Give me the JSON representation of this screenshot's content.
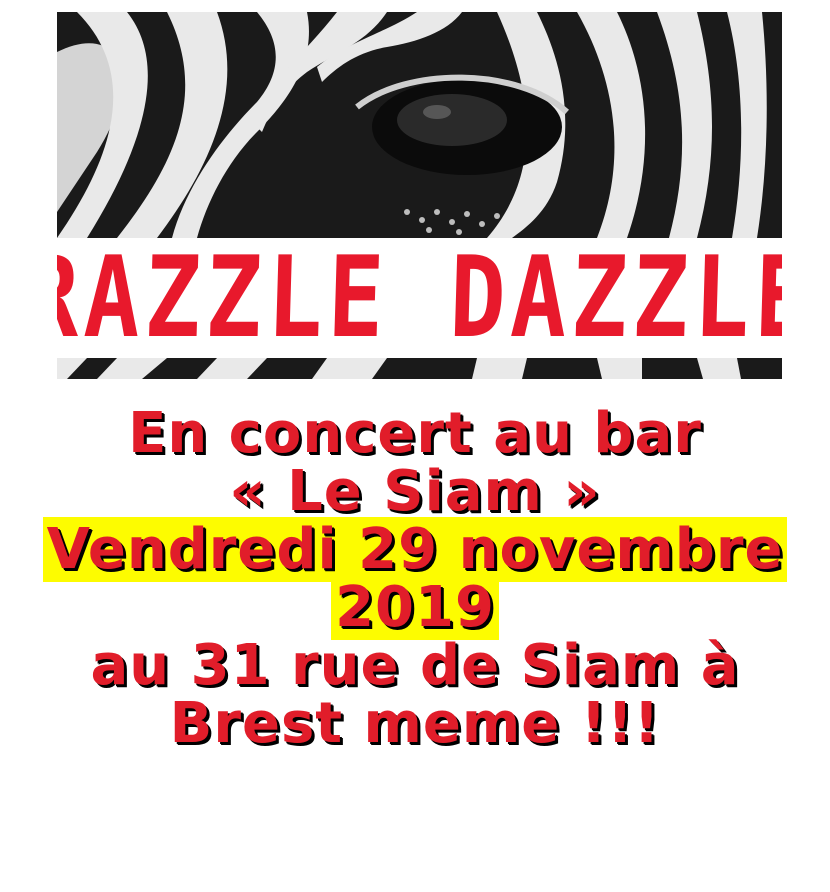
{
  "poster": {
    "band_name": "RAZZLE DAZZLE",
    "lines": [
      {
        "text": "En concert au bar",
        "highlight": false
      },
      {
        "text": "« Le Siam »",
        "highlight": false
      },
      {
        "text": "Vendredi 29 novembre",
        "highlight": true
      },
      {
        "text": "2019",
        "highlight": true
      },
      {
        "text": "au 31 rue de Siam à",
        "highlight": false
      },
      {
        "text": "Brest meme !!!",
        "highlight": false
      }
    ]
  },
  "colors": {
    "title_red": "#e8192c",
    "text_red": "#e11d2a",
    "highlight_yellow": "#fdfc00",
    "shadow": "#000000"
  },
  "image": {
    "subject": "zebra-eye-photo"
  }
}
